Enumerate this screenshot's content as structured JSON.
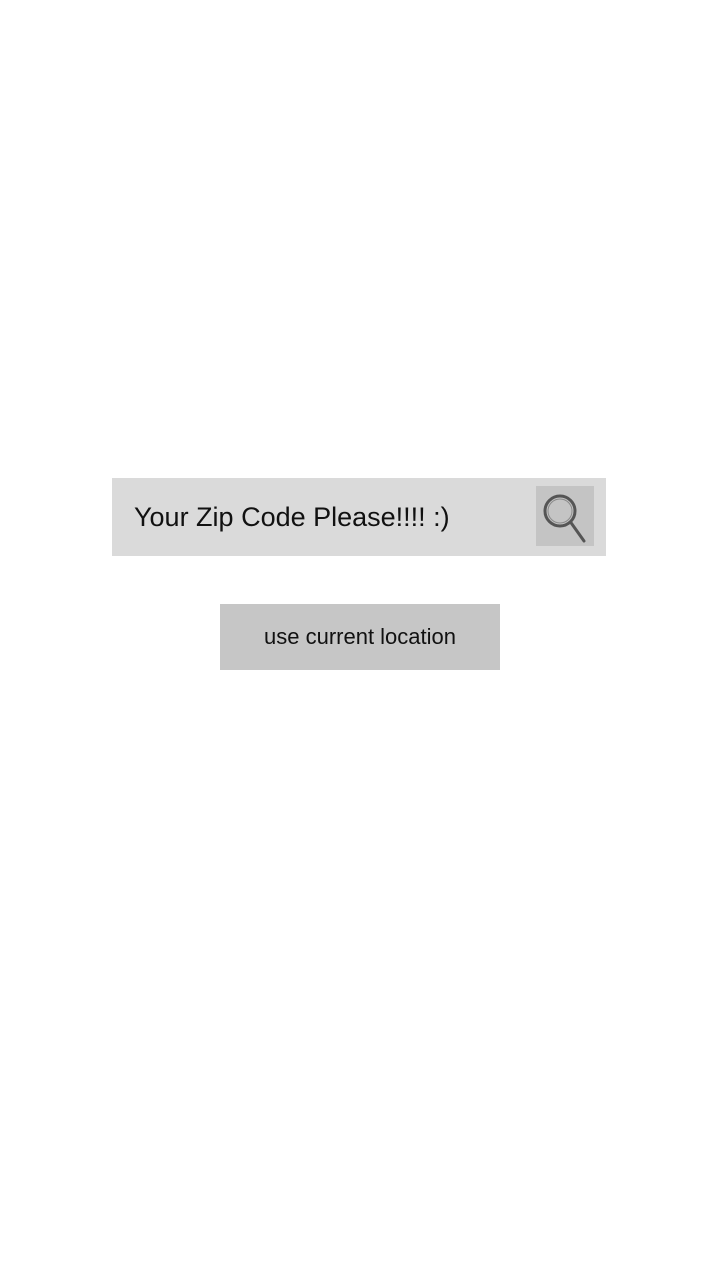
{
  "search": {
    "value": "",
    "placeholder": "Your Zip Code Please!!!! :)",
    "button_icon": "search-icon"
  },
  "location_button": {
    "label": "use current location"
  },
  "colors": {
    "background": "#ffffff",
    "search_bar": "#dadada",
    "search_button": "#c4c4c4",
    "location_button": "#c6c6c6",
    "text": "#111111"
  }
}
